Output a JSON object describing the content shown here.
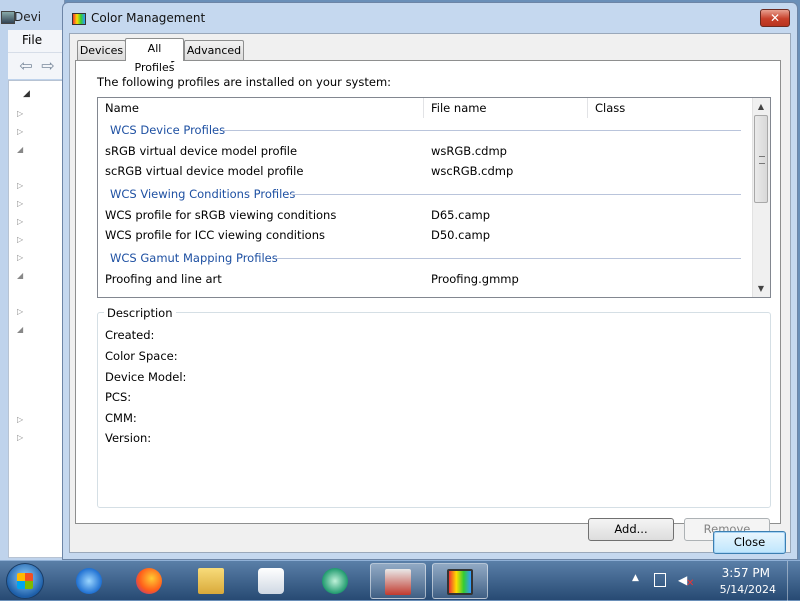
{
  "background_window": {
    "title": "Devi",
    "menu_file": "File"
  },
  "dialog": {
    "title": "Color Management",
    "close_glyph": "✕",
    "tabs": [
      {
        "label": "Devices"
      },
      {
        "label": "All Profiles"
      },
      {
        "label": "Advanced"
      }
    ],
    "installed_label": "The following profiles are installed on your system:",
    "columns": {
      "name": "Name",
      "file": "File name",
      "class": "Class"
    },
    "groups": [
      {
        "label": "WCS Device Profiles",
        "rows": [
          {
            "name": "sRGB virtual device model profile",
            "file": "wsRGB.cdmp"
          },
          {
            "name": "scRGB virtual device model profile",
            "file": "wscRGB.cdmp"
          }
        ]
      },
      {
        "label": "WCS Viewing Conditions Profiles",
        "rows": [
          {
            "name": "WCS profile for sRGB viewing conditions",
            "file": "D65.camp"
          },
          {
            "name": "WCS profile for ICC viewing conditions",
            "file": "D50.camp"
          }
        ]
      },
      {
        "label": "WCS Gamut Mapping Profiles",
        "rows": [
          {
            "name": "Proofing and line art",
            "file": "Proofing.gmmp"
          }
        ]
      }
    ],
    "description": {
      "legend": "Description",
      "fields": [
        "Created:",
        "Color Space:",
        "Device Model:",
        "PCS:",
        "CMM:",
        "Version:"
      ]
    },
    "buttons": {
      "add": "Add...",
      "remove": "Remove",
      "close": "Close"
    }
  },
  "taskbar": {
    "time": "3:57 PM",
    "date": "5/14/2024"
  },
  "colors": {
    "group_header": "#1e50a2",
    "titlebar": "#c5d8ef",
    "close_button": "#c8402a"
  }
}
